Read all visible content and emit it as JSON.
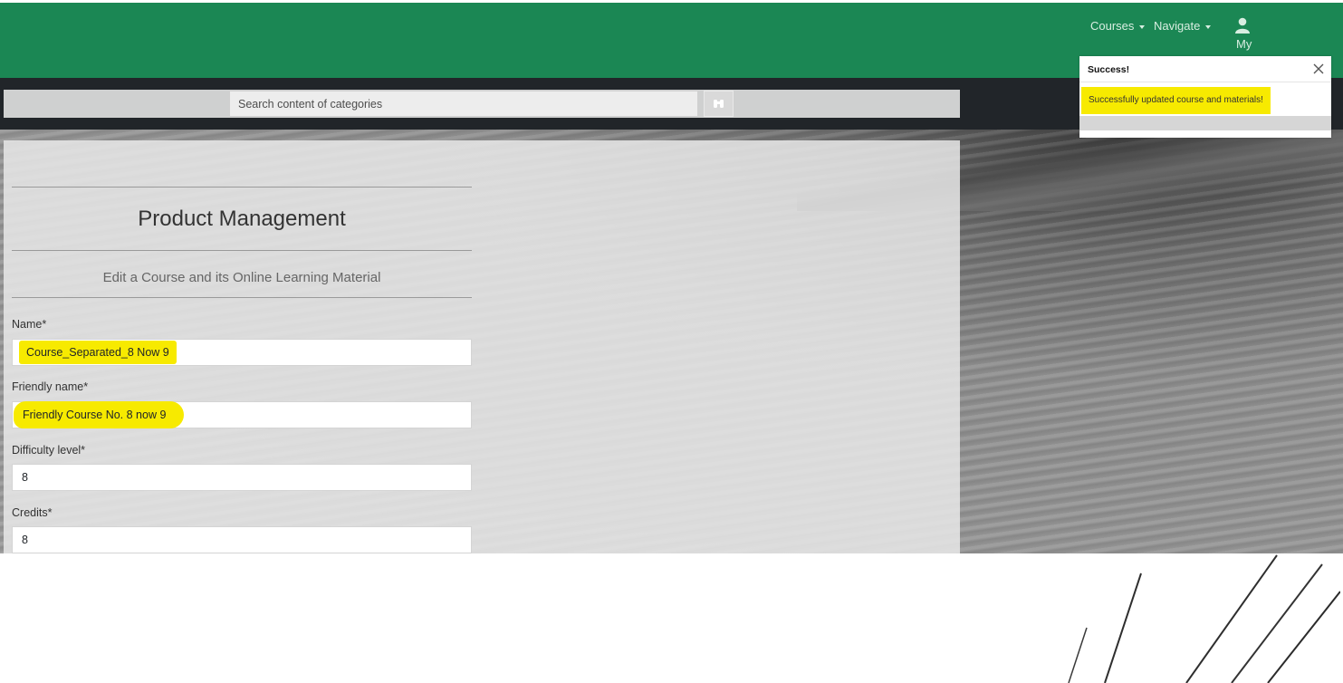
{
  "header": {
    "nav": [
      {
        "label": "Courses"
      },
      {
        "label": "Navigate"
      }
    ],
    "user_label": "My",
    "user_icon": "user-icon",
    "brand_color": "#1b8754"
  },
  "search": {
    "placeholder": "Search content of categories",
    "button_icon": "binoculars-icon"
  },
  "notification": {
    "title": "Success!",
    "message": "Successfully updated course and materials!",
    "close_icon": "close-icon",
    "highlight_color": "#f7ea00"
  },
  "main": {
    "title": "Product Management",
    "subtitle": "Edit a Course and its Online Learning Material",
    "fields": [
      {
        "label": "Name*",
        "value": "Course_Separated_8 Now 9"
      },
      {
        "label": "Friendly name*",
        "value": "Friendly Course No. 8  now 9"
      },
      {
        "label": "Difficulty level*",
        "value": "8"
      },
      {
        "label": "Credits*",
        "value": "8"
      }
    ]
  }
}
